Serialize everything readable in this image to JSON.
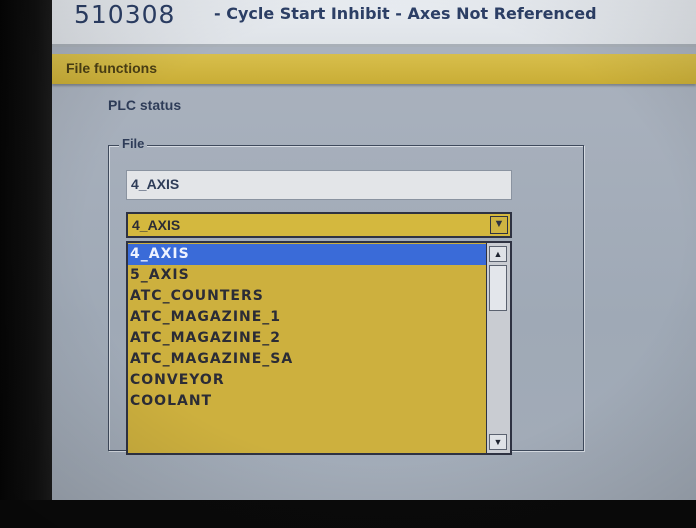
{
  "alarm": {
    "number": "510308",
    "message": "- Cycle Start Inhibit - Axes Not Referenced"
  },
  "window": {
    "title": "File functions"
  },
  "plc": {
    "label": "PLC status"
  },
  "file_group": {
    "label": "File",
    "input_value": "4_AXIS",
    "combo_value": "4_AXIS",
    "options": [
      "4_AXIS",
      "5_AXIS",
      "ATC_COUNTERS",
      "ATC_MAGAZINE_1",
      "ATC_MAGAZINE_2",
      "ATC_MAGAZINE_SA",
      "CONVEYOR",
      "COOLANT"
    ],
    "selected_index": 0
  },
  "icons": {
    "combo_button": "chevron-down-icon",
    "scroll_up": "arrow-up-icon",
    "scroll_down": "arrow-down-icon"
  },
  "colors": {
    "title_bar": "#c9ad36",
    "list_background": "#cdb03e",
    "selection": "#3a6bd8",
    "panel": "#a6afbb"
  }
}
